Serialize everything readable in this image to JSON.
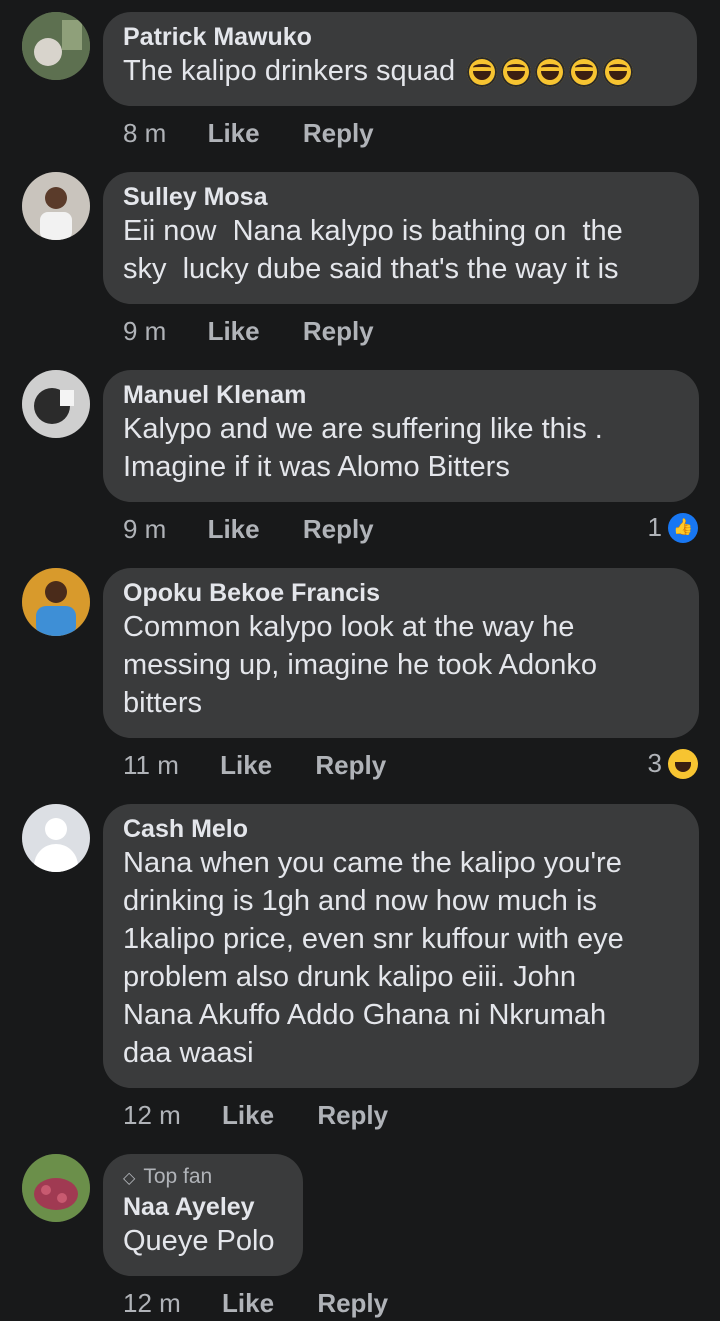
{
  "comments": [
    {
      "name": "Patrick Mawuko",
      "text": "The kalipo drinkers squad",
      "emoji_count": 5,
      "time": "8 m",
      "like_label": "Like",
      "reply_label": "Reply",
      "avatar_icon": "photo-avatar",
      "avatar_color": "#6a7b58"
    },
    {
      "name": "Sulley Mosa",
      "text": "Eii now  Nana kalypo is bathing on  the\nsky  lucky dube said that's the way it is",
      "time": "9 m",
      "like_label": "Like",
      "reply_label": "Reply",
      "avatar_icon": "photo-avatar",
      "avatar_color": "#c8c3bc"
    },
    {
      "name": "Manuel Klenam",
      "text": "Kalypo and we are suffering like this .\nImagine if it was Alomo Bitters",
      "time": "9 m",
      "like_label": "Like",
      "reply_label": "Reply",
      "reaction_count": "1",
      "reaction_icon": "like-reaction-icon",
      "avatar_icon": "photo-avatar",
      "avatar_color": "#d0d0d0"
    },
    {
      "name": "Opoku Bekoe Francis",
      "text": "Common kalypo look at the way he\nmessing up, imagine he took Adonko\nbitters",
      "time": "11 m",
      "like_label": "Like",
      "reply_label": "Reply",
      "reaction_count": "3",
      "reaction_icon": "haha-reaction-icon",
      "avatar_icon": "photo-avatar",
      "avatar_color": "#e0a030"
    },
    {
      "name": "Cash Melo",
      "text": "Nana when you came the kalipo you're\ndrinking is 1gh and now how much is\n1kalipo price, even snr kuffour with eye\nproblem also drunk kalipo eiii. John\nNana Akuffo Addo Ghana ni Nkrumah\ndaa waasi",
      "time": "12 m",
      "like_label": "Like",
      "reply_label": "Reply",
      "avatar_icon": "default-avatar"
    },
    {
      "badge": "Top fan",
      "name": "Naa Ayeley",
      "text": "Queye Polo",
      "time": "12 m",
      "like_label": "Like",
      "reply_label": "Reply",
      "avatar_icon": "photo-avatar",
      "avatar_color": "#8a5a4a"
    }
  ]
}
